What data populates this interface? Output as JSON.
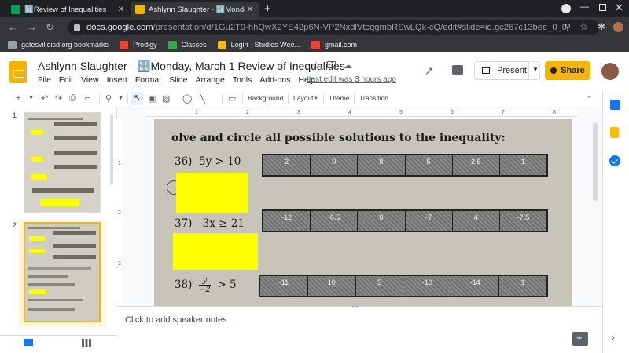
{
  "browser": {
    "tabs": [
      {
        "title": "🔣Review of Inequalities",
        "active": false,
        "favicon_color": "#0f9d58"
      },
      {
        "title": "Ashlynn Slaughter - 🔣Monday, M",
        "active": true,
        "favicon_color": "#f4b400"
      }
    ],
    "url_host": "docs.google.com",
    "url_path": "/presentation/d/1Gu2T9-hhQwX2YE42p6N-VP2NxdlVtcqgmbRSwLQk-cQ/edit#slide=id.gc267c13bee_0_0",
    "bookmarks": [
      {
        "label": "gatesvilleisd.org bookmarks",
        "color": "#9aa0a6"
      },
      {
        "label": "Prodigy",
        "color": "#ea4335"
      },
      {
        "label": "Classes",
        "color": "#34a853"
      },
      {
        "label": "Login - Studies Wee...",
        "color": "#fbbc04"
      },
      {
        "label": "gmail.com",
        "color": "#ea4335"
      }
    ]
  },
  "doc": {
    "title": "Ashlynn Slaughter - 🔣Monday, March 1 Review of Inequalities",
    "menu": [
      "File",
      "Edit",
      "View",
      "Insert",
      "Format",
      "Slide",
      "Arrange",
      "Tools",
      "Add-ons",
      "Help"
    ],
    "last_edit": "Last edit was 3 hours ago",
    "present_label": "Present",
    "share_label": "Share"
  },
  "toolbar": {
    "background": "Background",
    "layout": "Layout",
    "theme": "Theme",
    "transition": "Transition"
  },
  "filmstrip": {
    "slide_numbers": [
      "1",
      "2"
    ],
    "selected": 2
  },
  "ruler": {
    "h_numbers": [
      "1",
      "2",
      "3",
      "4",
      "5",
      "6",
      "7",
      "8"
    ],
    "v_numbers": [
      "1",
      "2",
      "3"
    ]
  },
  "slide": {
    "heading": "olve and circle all possible solutions to the inequality:",
    "problems": [
      {
        "number": "36)",
        "expr": "5y  >  10",
        "choices": [
          "2",
          "0",
          "8",
          "5",
          "2.5",
          "1"
        ]
      },
      {
        "number": "37)",
        "expr": "-3x  ≥  21",
        "choices": [
          "-12",
          "-6.5",
          "0",
          "-7",
          "4",
          "-7.5"
        ]
      },
      {
        "number": "38)",
        "frac_num": "y",
        "frac_den": "−2",
        "expr_tail": "> 5",
        "choices": [
          "-11",
          "10",
          "5",
          "-10",
          "-14",
          "1"
        ]
      }
    ]
  },
  "notes": {
    "placeholder": "Click to add speaker notes"
  },
  "colors": {
    "accent": "#f4b400",
    "highlight": "#ffff00",
    "link": "#1a73e8"
  }
}
